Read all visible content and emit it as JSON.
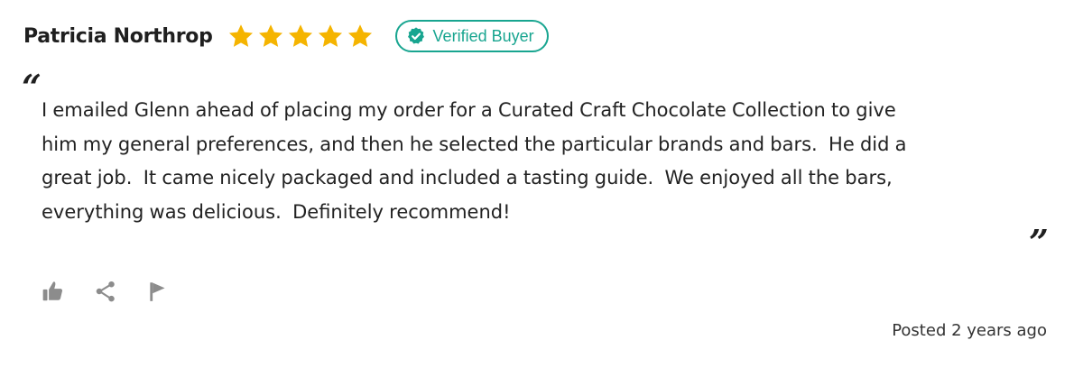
{
  "review": {
    "author": "Patricia Northrop",
    "rating": 5,
    "max_rating": 5,
    "verified_label": "Verified Buyer",
    "quote_open": "“",
    "quote_close": "”",
    "text": "I emailed Glenn ahead of placing my order for a Curated Craft Chocolate Collection to give\nhim my general preferences, and then he selected the particular brands and bars.  He did a\ngreat job.  It came nicely packaged and included a tasting guide.  We enjoyed all the bars,\neverything was delicious.  Definitely recommend!",
    "posted": "Posted 2 years ago"
  },
  "actions": [
    {
      "name": "thumbs-up",
      "icon": "thumbs-up-icon"
    },
    {
      "name": "share",
      "icon": "share-icon"
    },
    {
      "name": "flag",
      "icon": "flag-icon"
    }
  ],
  "colors": {
    "star": "#F5B400",
    "verified": "#18A590",
    "icon": "#8C8C8C",
    "text": "#222222"
  }
}
